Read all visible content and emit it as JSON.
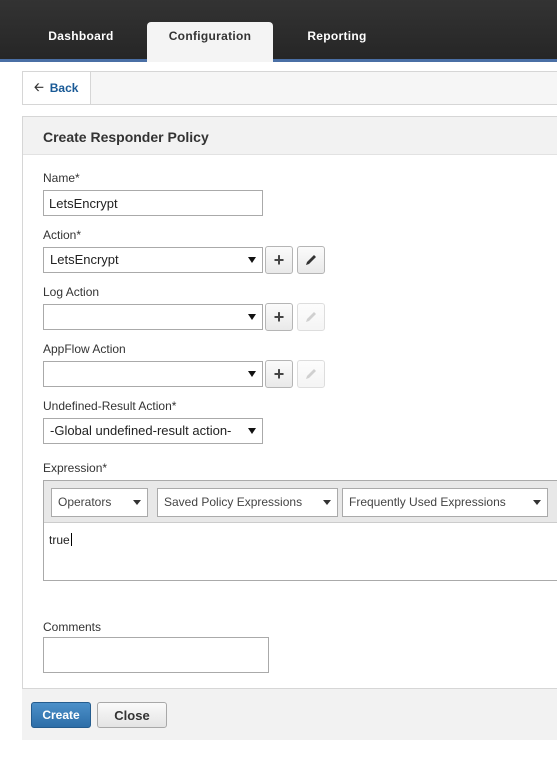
{
  "nav": {
    "tabs": [
      {
        "label": "Dashboard",
        "active": false
      },
      {
        "label": "Configuration",
        "active": true
      },
      {
        "label": "Reporting",
        "active": false
      }
    ]
  },
  "back": {
    "label": "Back",
    "icon": "arrow-left-icon"
  },
  "panel": {
    "title": "Create Responder Policy"
  },
  "form": {
    "name": {
      "label": "Name*",
      "value": "LetsEncrypt"
    },
    "action": {
      "label": "Action*",
      "value": "LetsEncrypt"
    },
    "log_action": {
      "label": "Log Action",
      "value": ""
    },
    "appflow_action": {
      "label": "AppFlow Action",
      "value": ""
    },
    "undefined_result_action": {
      "label": "Undefined-Result Action*",
      "value": "-Global undefined-result action-"
    },
    "expression": {
      "label": "Expression*",
      "operators": "Operators",
      "saved_policy_expressions": "Saved Policy Expressions",
      "frequently_used_expressions": "Frequently Used Expressions",
      "value": "true"
    },
    "comments": {
      "label": "Comments",
      "value": ""
    }
  },
  "buttons": {
    "create": "Create",
    "close": "Close"
  },
  "colors": {
    "accent": "#2d6ea8",
    "nav_bg": "#262626",
    "nav_border": "#4a6fa5"
  }
}
